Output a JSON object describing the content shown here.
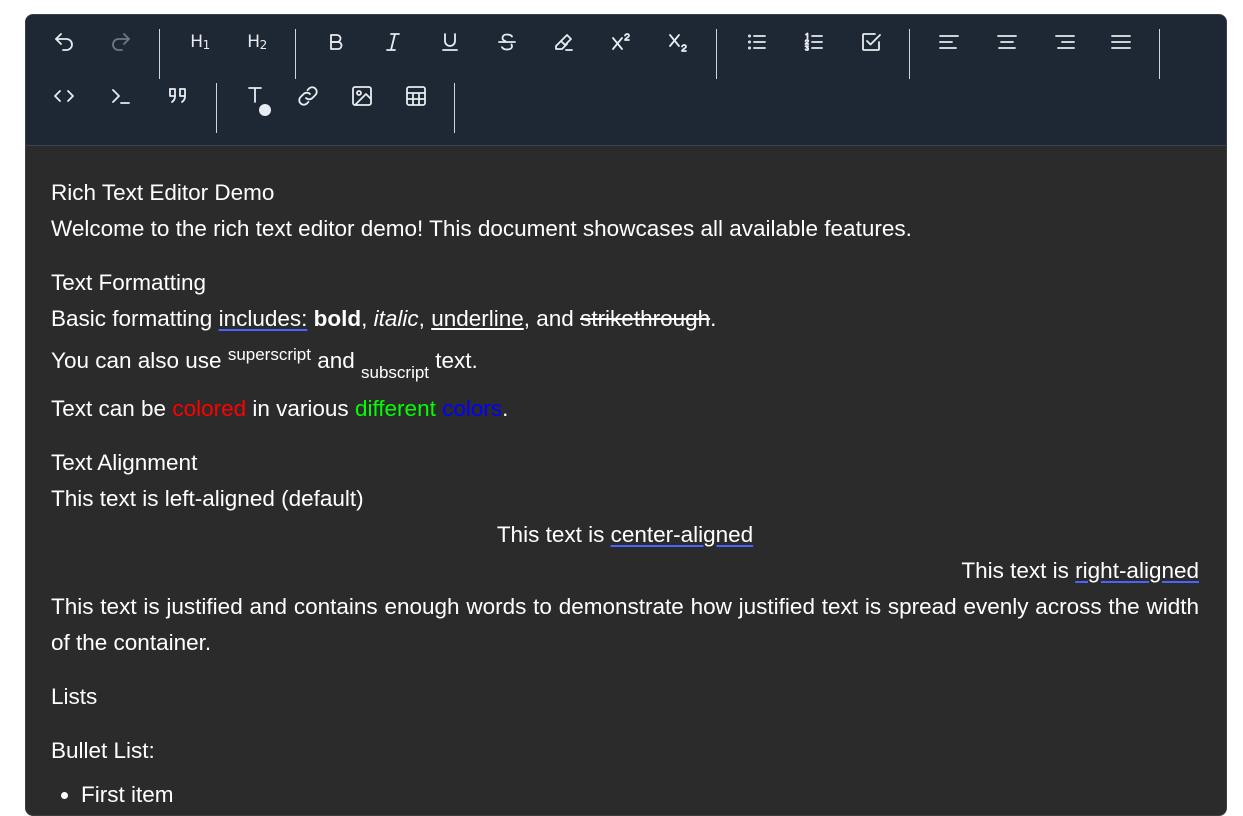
{
  "toolbar": {
    "history": [
      {
        "name": "undo-icon",
        "disabled": false
      },
      {
        "name": "redo-icon",
        "disabled": true
      }
    ],
    "headings": [
      {
        "label": "H",
        "sub": "1"
      },
      {
        "label": "H",
        "sub": "2"
      }
    ]
  },
  "document": {
    "title": "Rich Text Editor Demo",
    "intro": "Welcome to the rich text editor demo! This document showcases all available features.",
    "formatting": {
      "heading": "Text Formatting",
      "line1": {
        "prefix": "Basic formatting ",
        "includes": "includes:",
        "space": " ",
        "bold": "bold",
        "comma1": ", ",
        "italic": "italic",
        "comma2": ", ",
        "underline": "underline",
        "and": ", and ",
        "strike": "strikethrough",
        "end": "."
      },
      "line2": {
        "prefix": "You can also use ",
        "superscript": "superscript",
        "and": " and ",
        "subscript": "subscript",
        "end": " text."
      },
      "line3": {
        "prefix": "Text can be ",
        "colored": "colored",
        "middle": " in various ",
        "different": "different",
        "space": " ",
        "colors": "colors",
        "end": "."
      },
      "colors": {
        "red": "#ff0000",
        "green": "#00ff00",
        "blue": "#0000ff"
      }
    },
    "alignment": {
      "heading": "Text Alignment",
      "left": "This text is left-aligned (default)",
      "center_prefix": "This text is ",
      "center_word": "center-aligned",
      "right_prefix": "This text is ",
      "right_word": "right-aligned",
      "justified": "This text is justified and contains enough words to demonstrate how justified text is spread evenly across the width of the container."
    },
    "lists": {
      "heading": "Lists",
      "bullet_heading": "Bullet List:",
      "items": [
        "First item"
      ]
    }
  }
}
